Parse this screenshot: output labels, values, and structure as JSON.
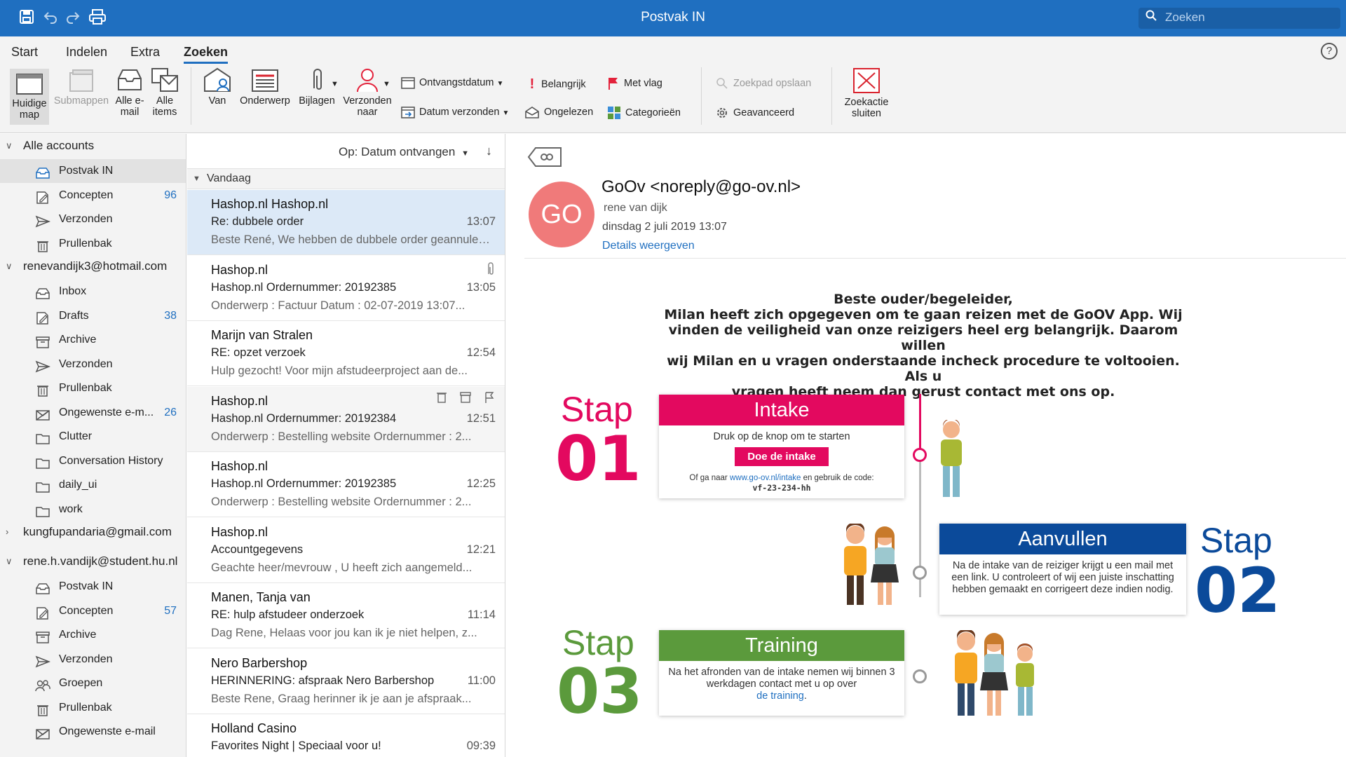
{
  "window": {
    "title": "Postvak IN",
    "search_placeholder": "Zoeken"
  },
  "ribbon": {
    "tabs": [
      "Start",
      "Indelen",
      "Extra",
      "Zoeken"
    ],
    "active_tab": "Zoeken",
    "scope_buttons": [
      {
        "label": "Huidige map",
        "icon": "current-folder-icon"
      },
      {
        "label": "Submappen",
        "icon": "subfolders-icon",
        "disabled": true
      },
      {
        "label": "Alle e-mail",
        "icon": "all-mail-icon"
      },
      {
        "label": "Alle items",
        "icon": "all-items-icon"
      }
    ],
    "refine_buttons": [
      {
        "label": "Van",
        "icon": "from-icon"
      },
      {
        "label": "Onderwerp",
        "icon": "subject-icon"
      },
      {
        "label": "Bijlagen",
        "icon": "attachment-icon"
      },
      {
        "label": "Verzonden naar",
        "icon": "sent-to-icon"
      }
    ],
    "small_buttons": {
      "received_date": "Ontvangstdatum",
      "sent_date": "Datum verzonden",
      "important": "Belangrijk",
      "unread": "Ongelezen",
      "flagged": "Met vlag",
      "categories": "Categorieën",
      "save_search": "Zoekpad opslaan",
      "advanced": "Geavanceerd"
    },
    "close_search": "Zoekactie sluiten"
  },
  "sidebar": {
    "accounts": [
      {
        "name": "Alle accounts",
        "expanded": true,
        "folders": [
          {
            "name": "Postvak IN",
            "icon": "inbox-icon",
            "selected": true
          },
          {
            "name": "Concepten",
            "icon": "drafts-icon",
            "count": "96"
          },
          {
            "name": "Verzonden",
            "icon": "sent-icon"
          },
          {
            "name": "Prullenbak",
            "icon": "trash-icon"
          }
        ]
      },
      {
        "name": "renevandijk3@hotmail.com",
        "expanded": true,
        "folders": [
          {
            "name": "Inbox",
            "icon": "inbox-icon"
          },
          {
            "name": "Drafts",
            "icon": "drafts-icon",
            "count": "38"
          },
          {
            "name": "Archive",
            "icon": "archive-icon"
          },
          {
            "name": "Verzonden",
            "icon": "sent-icon"
          },
          {
            "name": "Prullenbak",
            "icon": "trash-icon"
          },
          {
            "name": "Ongewenste e-m...",
            "icon": "junk-icon",
            "count": "26"
          },
          {
            "name": "Clutter",
            "icon": "folder-icon"
          },
          {
            "name": "Conversation History",
            "icon": "folder-icon"
          },
          {
            "name": "daily_ui",
            "icon": "folder-icon"
          },
          {
            "name": "work",
            "icon": "folder-icon"
          }
        ]
      },
      {
        "name": "kungfupandaria@gmail.com",
        "expanded": false,
        "folders": []
      },
      {
        "name": "rene.h.vandijk@student.hu.nl",
        "expanded": true,
        "folders": [
          {
            "name": "Postvak IN",
            "icon": "inbox-icon"
          },
          {
            "name": "Concepten",
            "icon": "drafts-icon",
            "count": "57"
          },
          {
            "name": "Archive",
            "icon": "archive-icon"
          },
          {
            "name": "Verzonden",
            "icon": "sent-icon"
          },
          {
            "name": "Groepen",
            "icon": "groups-icon"
          },
          {
            "name": "Prullenbak",
            "icon": "trash-icon"
          },
          {
            "name": "Ongewenste e-mail",
            "icon": "junk-icon"
          }
        ]
      }
    ]
  },
  "message_list": {
    "sort_label": "Op: Datum ontvangen",
    "group_label": "Vandaag",
    "messages": [
      {
        "from": "Hashop.nl Hashop.nl",
        "subject": "Re: dubbele order",
        "time": "13:07",
        "preview": "Beste René, We hebben de dubbele order geannuleerd...",
        "selected": true
      },
      {
        "from": "Hashop.nl",
        "subject": "Hashop.nl Ordernummer: 20192385",
        "time": "13:05",
        "preview": "Onderwerp : Factuur Datum : 02-07-2019 13:07...",
        "attachment": true
      },
      {
        "from": "Marijn van Stralen",
        "subject": "RE: opzet verzoek",
        "time": "12:54",
        "preview": "Hulp gezocht! Voor mijn afstudeerproject aan de..."
      },
      {
        "from": "Hashop.nl",
        "subject": "Hashop.nl Ordernummer: 20192384",
        "time": "12:51",
        "preview": "Onderwerp : Bestelling website Ordernummer : 2...",
        "hover": true
      },
      {
        "from": "Hashop.nl",
        "subject": "Hashop.nl Ordernummer: 20192385",
        "time": "12:25",
        "preview": "Onderwerp : Bestelling website Ordernummer : 2..."
      },
      {
        "from": "Hashop.nl",
        "subject": "Accountgegevens",
        "time": "12:21",
        "preview": "Geachte heer/mevrouw , U heeft zich aangemeld..."
      },
      {
        "from": "Manen, Tanja van",
        "subject": "RE: hulp afstudeer onderzoek",
        "time": "11:14",
        "preview": "Dag Rene, Helaas voor jou kan ik je niet helpen, z..."
      },
      {
        "from": "Nero Barbershop",
        "subject": "HERINNERING: afspraak Nero Barbershop",
        "time": "11:00",
        "preview": "Beste Rene, Graag herinner ik je aan je afspraak..."
      },
      {
        "from": "Holland Casino",
        "subject": "Favorites Night | Speciaal voor u!",
        "time": "09:39",
        "preview": ""
      }
    ]
  },
  "reading": {
    "avatar_initials": "GO",
    "avatar_color": "#f07a7a",
    "sender": "GoOv <noreply@go-ov.nl>",
    "to": "rene van dijk",
    "date": "dinsdag 2 juli 2019 13:07",
    "details_link": "Details weergeven",
    "greeting_lines": [
      "Beste ouder/begeleider,",
      "Milan heeft zich opgegeven om te gaan reizen met de GoOV App. Wij",
      "vinden de veiligheid van onze reizigers heel erg belangrijk. Daarom willen",
      "wij Milan en u vragen onderstaande incheck procedure te voltooien. Als u",
      "vragen heeft neem dan gerust contact met ons op."
    ],
    "steps": [
      {
        "word": "Stap",
        "num": "01",
        "title": "Intake",
        "color": "#e3095f",
        "text": "Druk op de knop om te starten",
        "button": "Doe de intake",
        "alt_prefix": "Of ga naar ",
        "alt_link": "www.go-ov.nl/intake",
        "alt_suffix": " en gebruik de code:",
        "code": "vf-23-234-hh"
      },
      {
        "word": "Stap",
        "num": "02",
        "title": "Aanvullen",
        "color": "#0b4a9a",
        "text": "Na de intake van de reiziger krijgt u een mail met een link. U controleert of wij een juiste inschatting hebben gemaakt en corrigeert deze indien nodig."
      },
      {
        "word": "Stap",
        "num": "03",
        "title": "Training",
        "color": "#5b9a3c",
        "text": "Na het afronden van de intake nemen wij binnen 3 werkdagen contact met u op over",
        "link": "de training",
        "suffix": "."
      }
    ]
  }
}
